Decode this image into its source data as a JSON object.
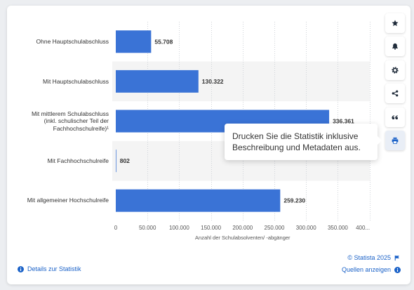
{
  "colors": {
    "bar": "#3a73d6",
    "link": "#1b62c8",
    "icon": "#1f2b3a",
    "row_shade": "#f4f4f4"
  },
  "sidebar": {
    "buttons": [
      {
        "icon": "star-icon"
      },
      {
        "icon": "bell-icon"
      },
      {
        "icon": "gear-icon"
      },
      {
        "icon": "share-icon"
      },
      {
        "icon": "quote-icon"
      },
      {
        "icon": "print-icon",
        "active": true
      }
    ]
  },
  "tooltip": {
    "text": "Drucken Sie die Statistik inklusive Beschreibung und Metadaten aus."
  },
  "footer": {
    "copyright": "© Statista 2025",
    "copyright_icon": "flag-icon",
    "details_link": "Details zur Statistik",
    "details_icon": "info-icon",
    "sources_link": "Quellen anzeigen",
    "sources_icon": "info-icon"
  },
  "chart_data": {
    "type": "bar",
    "orientation": "horizontal",
    "categories": [
      "Ohne Hauptschulabschluss",
      "Mit Hauptschulabschluss",
      "Mit mittlerem Schulabschluss (inkl. schulischer Teil der Fachhochschulreife)¹",
      "Mit Fachhochschulreife",
      "Mit allgemeiner Hochschulreife"
    ],
    "values": [
      55708,
      130322,
      336361,
      802,
      259230
    ],
    "value_labels": [
      "55.708",
      "130.322",
      "336.361",
      "802",
      "259.230"
    ],
    "xlabel": "Anzahl der Schulabsolventen/ -abgänger",
    "xlim": [
      0,
      400000
    ],
    "x_ticks": [
      0,
      50000,
      100000,
      150000,
      200000,
      250000,
      300000,
      350000,
      400000
    ],
    "x_tick_labels": [
      "0",
      "50.000",
      "100.000",
      "150.000",
      "200.000",
      "250.000",
      "300.000",
      "350.000",
      "400..."
    ],
    "grid": true
  }
}
